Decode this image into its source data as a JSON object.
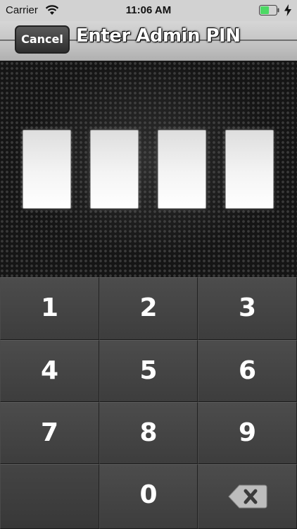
{
  "status_bar": {
    "carrier": "Carrier",
    "time": "11:06 AM",
    "wifi_icon": "wifi-icon",
    "battery_icon": "battery-icon",
    "charging_icon": "charging-bolt-icon",
    "battery_level": 0.55
  },
  "header": {
    "cancel_label": "Cancel",
    "title": "Enter Admin PIN"
  },
  "pin": {
    "length": 4,
    "entered": [
      "",
      "",
      "",
      ""
    ]
  },
  "keypad": {
    "keys": [
      [
        "1",
        "2",
        "3"
      ],
      [
        "4",
        "5",
        "6"
      ],
      [
        "7",
        "8",
        "9"
      ],
      [
        "",
        "0",
        "backspace"
      ]
    ],
    "backspace_icon": "backspace-icon"
  },
  "colors": {
    "title_text": "#ffffff",
    "keypad_background": "#3d3d3d",
    "battery_fill": "#4cd964"
  }
}
